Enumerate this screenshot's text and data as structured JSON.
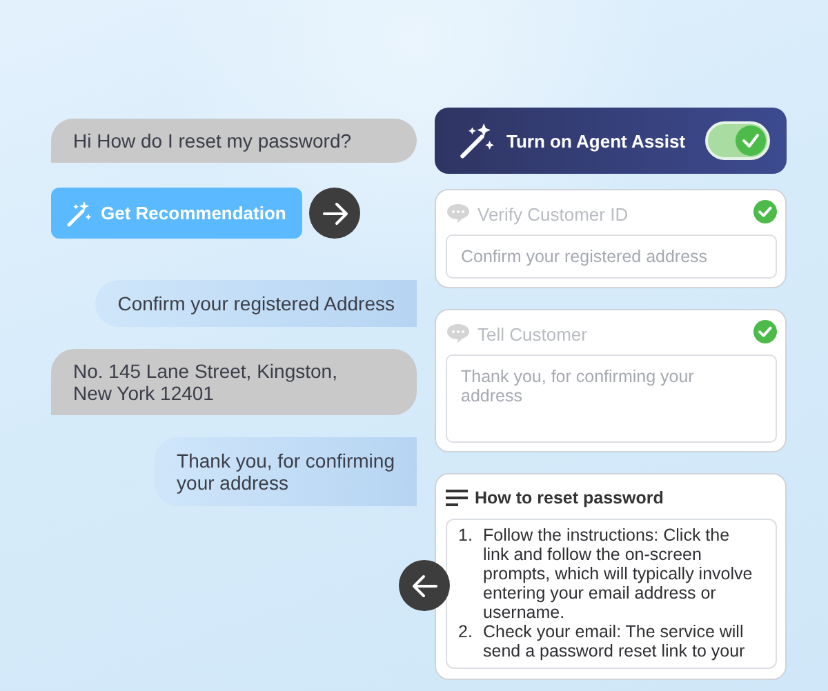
{
  "conversation": [
    {
      "kind": "customer",
      "text": "Hi How do I reset my password?"
    },
    {
      "kind": "action",
      "label": "Get Recommendation"
    },
    {
      "kind": "agent",
      "text": "Confirm your registered Address"
    },
    {
      "kind": "customer",
      "text": "No. 145 Lane Street, Kingston,\nNew York 12401"
    },
    {
      "kind": "agent",
      "text": "Thank you, for confirming\nyour address"
    }
  ],
  "agent_assist": {
    "title": "Turn on Agent Assist",
    "on": true
  },
  "cards": [
    {
      "kind": "field",
      "title": "Verify Customer ID",
      "done": true,
      "value": "Confirm your registered address"
    },
    {
      "kind": "textarea",
      "title": "Tell Customer",
      "done": true,
      "value": "Thank you, for confirming your address"
    },
    {
      "kind": "steps",
      "title": "How to reset password",
      "steps": [
        {
          "number": "1.",
          "text": "Follow the instructions: Click the link and follow the on-screen prompts, which will typically involve entering your email address or username."
        },
        {
          "number": "2.",
          "text": "Check your email: The service will send a password reset link to your"
        }
      ]
    }
  ]
}
